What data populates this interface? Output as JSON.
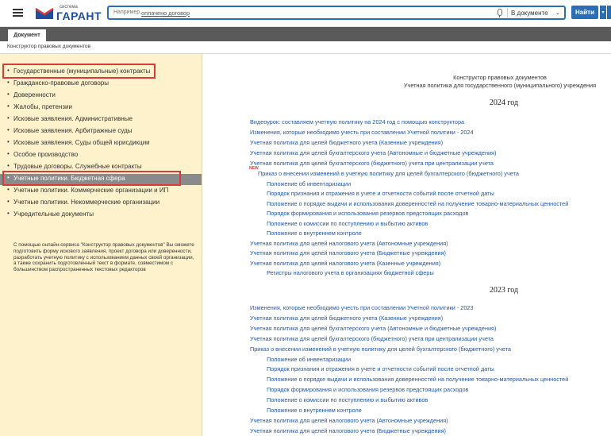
{
  "app": {
    "logo_small": "система",
    "logo_big": "ГАРАНТ",
    "search_prefix": "Например,",
    "search_example": "оплачено договор",
    "search_scope": "В документе",
    "search_button": "Найти",
    "accent_color": "#2a6fb6"
  },
  "tabs": [
    {
      "label": "Документ"
    }
  ],
  "breadcrumb": "Конструктор правовых документов",
  "sidebar": {
    "items": [
      {
        "label": "Государственные (муниципальные) контракты"
      },
      {
        "label": "Гражданско-правовые договоры"
      },
      {
        "label": "Доверенности"
      },
      {
        "label": "Жалобы, претензии"
      },
      {
        "label": "Исковые заявления. Административные"
      },
      {
        "label": "Исковые заявления. Арбитражные суды"
      },
      {
        "label": "Исковые заявления. Суды общей юрисдикции"
      },
      {
        "label": "Особое производство"
      },
      {
        "label": "Трудовые договоры. Служебные контракты"
      },
      {
        "label": "Учетные политики. Бюджетная сфера"
      },
      {
        "label": "Учетные политики. Коммерческие организации и ИП"
      },
      {
        "label": "Учетные политики. Некоммерческие организации"
      },
      {
        "label": "Учредительные документы"
      }
    ],
    "description": "С помощью онлайн-сервиса \"Конструктор правовых документов\" Вы сможете подготовить форму искового заявления, проект договора или доверенности, разработать учетную политику с использованием данных своей организации, а также сохранить подготовленный текст в формате, совместимом с большинством распространенных текстовых редакторов"
  },
  "main": {
    "title_line1": "Конструктор правовых документов",
    "title_line2": "Учетная политика для государственного (муниципального) учреждения",
    "new_badge": "NEW",
    "section_2024": {
      "year": "2024 год",
      "links": [
        "Видеоурок: составляем учетную политику на 2024 год с помощью конструктора",
        "Изменения, которые необходимо учесть при составлении Учетной политики - 2024",
        "Учетная политика для целей бюджетного учета (Казенные учреждения)",
        "Учетная политика для целей бухгалтерского учета (Автономные и бюджетные учреждения)",
        "Учетная политика для целей бухгалтерского (бюджетного) учета при централизации учета",
        "Приказ о внесении изменений в учетную политику для целей бухгалтерского (бюджетного) учета",
        "Положение об инвентаризации",
        "Порядок признания и отражения в учете и отчетности событий после отчетной даты",
        "Положение о порядке выдачи и использования доверенностей на получение товарно-материальных ценностей",
        "Порядок формирования и использования резервов предстоящих расходов",
        "Положение о комиссии по поступлению и выбытию активов",
        "Положение о внутреннем контроле",
        "Учетная политика для целей налогового учета (Автономные учреждения)",
        "Учетная политика для целей налогового учета (Бюджетные учреждения)",
        "Учетная политика для целей налогового учета (Казенные учреждения)",
        "Регистры налогового учета в организациях бюджетной сферы"
      ]
    },
    "section_2023": {
      "year": "2023 год",
      "links": [
        "Изменения, которые необходимо учесть при составлении Учетной политики - 2023",
        "Учетная политика для целей бюджетного учета (Казенные учреждения)",
        "Учетная политика для целей бухгалтерского учета (Автономные и бюджетные учреждения)",
        "Учетная политика для целей бухгалтерского (бюджетного) учета при централизации учета",
        "Приказ о внесении изменений в учетную политику для целей бухгалтерского (бюджетного) учета",
        "Положение об инвентаризации",
        "Порядок признания и отражения в учете и отчетности событий после отчетной даты",
        "Положение о порядке выдачи и использования доверенностей на получение товарно-материальных ценностей",
        "Порядок формирования и использования резервов предстоящих расходов",
        "Положение о комиссии по поступлению и выбытию активов",
        "Положение о внутреннем контроле",
        "Учетная политика для целей налогового учета (Автономные учреждения)",
        "Учетная политика для целей налогового учета (Бюджетные учреждения)"
      ]
    }
  }
}
